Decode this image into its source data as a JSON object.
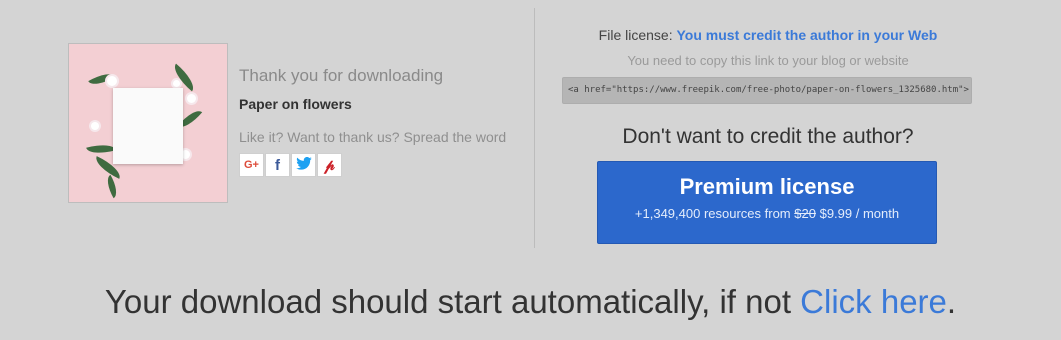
{
  "download": {
    "thanks_title": "Thank you for downloading",
    "resource_name": "Paper on flowers",
    "spread_text": "Like it? Want to thank us? Spread the word",
    "social": [
      {
        "icon": "google-plus-icon",
        "glyph": "G+",
        "color": "#dd4b39"
      },
      {
        "icon": "facebook-icon",
        "glyph": "f",
        "color": "#3b5998"
      },
      {
        "icon": "twitter-icon",
        "glyph": "🐦",
        "color": "#1da1f2"
      },
      {
        "icon": "pinterest-icon",
        "glyph": "P",
        "color": "#cb2027"
      }
    ]
  },
  "license": {
    "label": "File license:",
    "value": "You must credit the author in your Web",
    "copy_hint": "You need to copy this link to your blog or website",
    "code_snippet": "<a href=\"https://www.freepik.com/free-photo/paper-on-flowers_1325680.htm\">"
  },
  "premium": {
    "question": "Don't want to credit the author?",
    "button_title": "Premium license",
    "resources_text": "+1,349,400 resources from",
    "old_price": "$20",
    "new_price_text": "$9.99 / month"
  },
  "footer": {
    "download_text": "Your download should start automatically, if not",
    "click_here": "Click here",
    "period": "."
  },
  "colors": {
    "background": "#d4d4d4",
    "accent_link": "#3b7ad8",
    "premium_button": "#2c68cc"
  }
}
